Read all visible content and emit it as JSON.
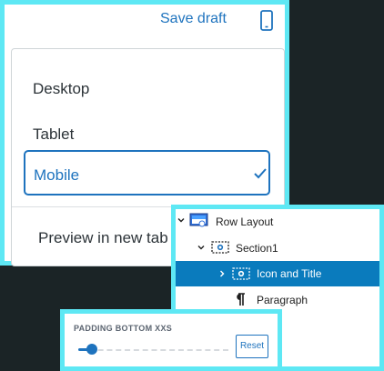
{
  "header": {
    "save_draft_label": "Save draft",
    "device_icon": "mobile-device-icon"
  },
  "preview_menu": {
    "items": [
      {
        "label": "Desktop",
        "selected": false
      },
      {
        "label": "Tablet",
        "selected": false
      },
      {
        "label": "Mobile",
        "selected": true
      }
    ],
    "preview_new_tab_label": "Preview in new tab"
  },
  "outline": {
    "items": [
      {
        "label": "Row Layout",
        "icon": "row-layout-icon",
        "expanded": true
      },
      {
        "label": "Section1",
        "icon": "section-icon",
        "expanded": true
      },
      {
        "label": "Icon and Title",
        "icon": "icon-title-block-icon",
        "expanded": false,
        "selected": true
      },
      {
        "label": "Paragraph",
        "icon": "paragraph-icon"
      }
    ]
  },
  "padding_control": {
    "label": "PADDING BOTTOM XXS",
    "slider_value_fraction": 0.05,
    "reset_label": "Reset"
  },
  "colors": {
    "accent": "#1e73be",
    "highlight_border": "#5ee8f4",
    "selected_row": "#0a7bbd",
    "background": "#1b2426"
  }
}
